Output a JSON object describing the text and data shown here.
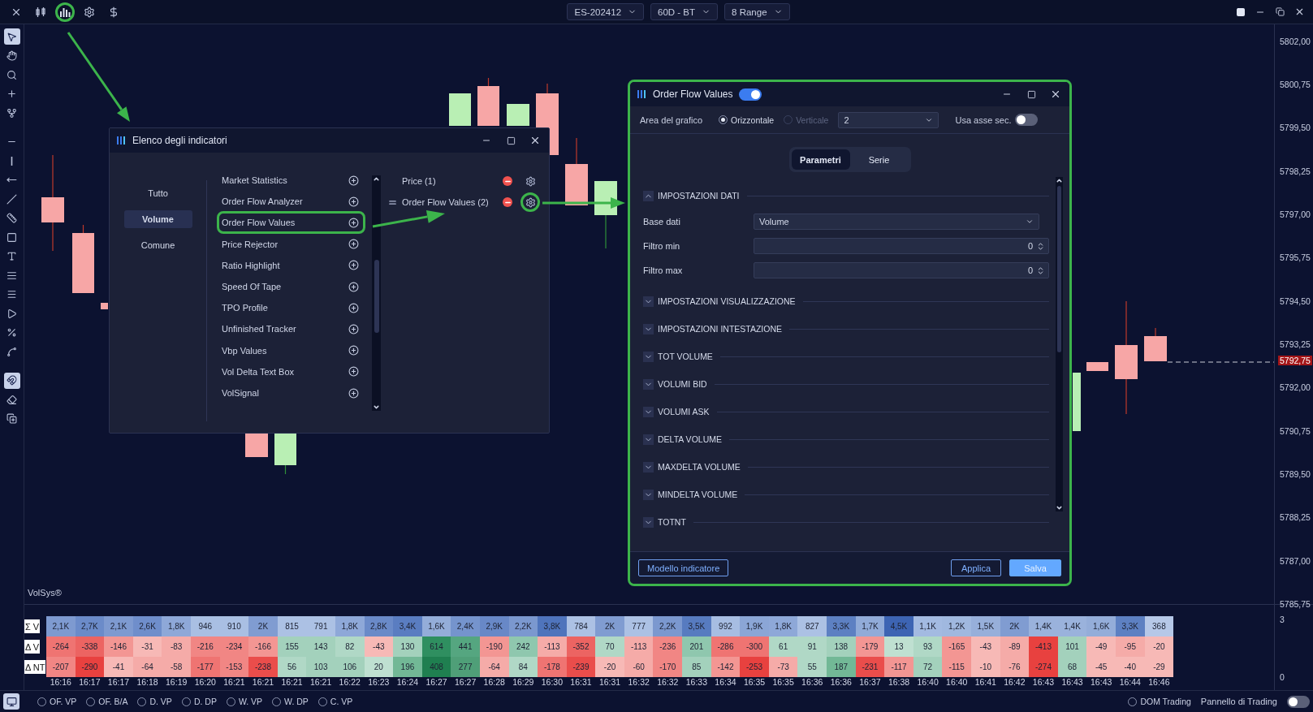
{
  "top_bar": {
    "tools": [
      {
        "highlighted": false
      },
      {
        "highlighted": false
      },
      {
        "highlighted": true
      },
      {
        "highlighted": false
      },
      {
        "highlighted": false
      }
    ],
    "selectors": [
      {
        "label": "ES-202412"
      },
      {
        "label": "60D - BT"
      },
      {
        "label": "8 Range"
      }
    ]
  },
  "left_toolbar": {
    "tools": [
      {
        "selected": true
      },
      {
        "selected": false
      },
      {
        "selected": false
      },
      {
        "selected": false
      },
      {
        "selected": false
      },
      {
        "selected": false
      },
      {
        "selected": false
      },
      {
        "selected": false
      },
      {
        "selected": false
      },
      {
        "selected": false
      },
      {
        "selected": false
      },
      {
        "selected": false
      },
      {
        "selected": false
      },
      {
        "selected": false
      },
      {
        "selected": false
      },
      {
        "selected": false
      },
      {
        "selected": false
      },
      {
        "selected": true
      },
      {
        "selected": false
      },
      {
        "selected": false
      }
    ]
  },
  "chart": {
    "study_label": "VolSys®"
  },
  "price_axis": {
    "labels": [
      "5802,00",
      "5800,75",
      "5799,50",
      "5798,25",
      "5797,00",
      "5795,75",
      "5794,50",
      "5793,25",
      "5792,00",
      "5790,75",
      "5789,50",
      "5788,25",
      "5787,00",
      "5785,75"
    ],
    "current_price": "5792,75",
    "sub_scale": [
      "3",
      "0"
    ]
  },
  "indicator_list_window": {
    "title": "Elenco degli indicatori",
    "categories": [
      {
        "label": "Tutto",
        "selected": false
      },
      {
        "label": "Volume",
        "selected": true
      },
      {
        "label": "Comune",
        "selected": false
      }
    ],
    "indicators": [
      {
        "label": "Market Statistics",
        "highlighted": false
      },
      {
        "label": "Order Flow Analyzer",
        "highlighted": false
      },
      {
        "label": "Order Flow Values",
        "highlighted": true
      },
      {
        "label": "Price Rejector",
        "highlighted": false
      },
      {
        "label": "Ratio Highlight",
        "highlighted": false
      },
      {
        "label": "Speed Of Tape",
        "highlighted": false
      },
      {
        "label": "TPO Profile",
        "highlighted": false
      },
      {
        "label": "Unfinished Tracker",
        "highlighted": false
      },
      {
        "label": "Vbp Values",
        "highlighted": false
      },
      {
        "label": "Vol Delta Text Box",
        "highlighted": false
      },
      {
        "label": "VolSignal",
        "highlighted": false
      }
    ],
    "added": [
      {
        "label": "Price (1)",
        "handle": false,
        "highlighted": false
      },
      {
        "label": "Order Flow Values (2)",
        "handle": true,
        "highlighted": true
      }
    ]
  },
  "settings_window": {
    "title": "Order Flow Values",
    "enabled": true,
    "highlighted": true,
    "chart_area_label": "Area del grafico",
    "orientation": [
      {
        "label": "Orizzontale",
        "selected": true,
        "disabled": false
      },
      {
        "label": "Verticale",
        "selected": false,
        "disabled": true
      }
    ],
    "pane": "2",
    "secondary_axis": {
      "label": "Usa asse sec.",
      "on": false
    },
    "tabs": [
      {
        "label": "Parametri",
        "selected": true
      },
      {
        "label": "Serie",
        "selected": false
      }
    ],
    "sections": [
      {
        "title": "IMPOSTAZIONI DATI",
        "expanded": true,
        "fields": [
          {
            "kind": "select",
            "label": "Base dati",
            "value": "Volume"
          },
          {
            "kind": "number",
            "label": "Filtro min",
            "value": "0"
          },
          {
            "kind": "number",
            "label": "Filtro max",
            "value": "0"
          }
        ]
      },
      {
        "title": "IMPOSTAZIONI VISUALIZZAZIONE",
        "expanded": false
      },
      {
        "title": "IMPOSTAZIONI INTESTAZIONE",
        "expanded": false
      },
      {
        "title": "TOT VOLUME",
        "expanded": false
      },
      {
        "title": "VOLUMI BID",
        "expanded": false
      },
      {
        "title": "VOLUMI ASK",
        "expanded": false
      },
      {
        "title": "DELTA VOLUME",
        "expanded": false
      },
      {
        "title": "MAXDELTA VOLUME",
        "expanded": false
      },
      {
        "title": "MINDELTA VOLUME",
        "expanded": false
      },
      {
        "title": "TOTNT",
        "expanded": false
      }
    ],
    "buttons": [
      {
        "label": "Modello indicatore",
        "kind": "outline"
      },
      {
        "label": "Applica",
        "kind": "outline"
      },
      {
        "label": "Salva",
        "kind": "primary"
      }
    ]
  },
  "volume_table": {
    "rows": [
      {
        "label": "Σ V",
        "cells": [
          {
            "text": "2,1K",
            "color": "#7e9ad0"
          },
          {
            "text": "2,7K",
            "color": "#6b8bc9"
          },
          {
            "text": "2,1K",
            "color": "#7e9ad0"
          },
          {
            "text": "2,6K",
            "color": "#6f8ecb"
          },
          {
            "text": "1,8K",
            "color": "#8ea8d8"
          },
          {
            "text": "946",
            "color": "#a9bfe3"
          },
          {
            "text": "910",
            "color": "#a9bfe3"
          },
          {
            "text": "2K",
            "color": "#809cd1"
          },
          {
            "text": "815",
            "color": "#acc1e4"
          },
          {
            "text": "791",
            "color": "#acc1e4"
          },
          {
            "text": "1,8K",
            "color": "#8ea8d8"
          },
          {
            "text": "2,8K",
            "color": "#6a8ac8"
          },
          {
            "text": "3,4K",
            "color": "#5a7dc1"
          },
          {
            "text": "1,6K",
            "color": "#94add9"
          },
          {
            "text": "2,4K",
            "color": "#7594cd"
          },
          {
            "text": "2,9K",
            "color": "#6888c7"
          },
          {
            "text": "2,2K",
            "color": "#7b98cf"
          },
          {
            "text": "3,8K",
            "color": "#4f74bc"
          },
          {
            "text": "784",
            "color": "#acc1e4"
          },
          {
            "text": "2K",
            "color": "#809cd1"
          },
          {
            "text": "777",
            "color": "#acc1e4"
          },
          {
            "text": "2,2K",
            "color": "#7b98cf"
          },
          {
            "text": "3,5K",
            "color": "#577bc0"
          },
          {
            "text": "992",
            "color": "#a7bde2"
          },
          {
            "text": "1,9K",
            "color": "#8ba6d6"
          },
          {
            "text": "1,8K",
            "color": "#8ea8d8"
          },
          {
            "text": "827",
            "color": "#acc1e4"
          },
          {
            "text": "3,3K",
            "color": "#5d80c2"
          },
          {
            "text": "1,7K",
            "color": "#91abd8"
          },
          {
            "text": "4,5K",
            "color": "#3d64b3"
          },
          {
            "text": "1,1K",
            "color": "#a3bae1"
          },
          {
            "text": "1,2K",
            "color": "#a0b8df"
          },
          {
            "text": "1,5K",
            "color": "#97afda"
          },
          {
            "text": "2K",
            "color": "#809cd1"
          },
          {
            "text": "1,4K",
            "color": "#9ab2dc"
          },
          {
            "text": "1,4K",
            "color": "#9ab2dc"
          },
          {
            "text": "1,6K",
            "color": "#94add9"
          },
          {
            "text": "3,3K",
            "color": "#5d80c2"
          },
          {
            "text": "368",
            "color": "#b6c8e8"
          }
        ]
      },
      {
        "label": "Δ V",
        "cells": [
          {
            "text": "-264",
            "color": "#ef7472"
          },
          {
            "text": "-338",
            "color": "#ec6462"
          },
          {
            "text": "-146",
            "color": "#f39693"
          },
          {
            "text": "-31",
            "color": "#f7b9b6"
          },
          {
            "text": "-83",
            "color": "#f5aba8"
          },
          {
            "text": "-216",
            "color": "#f18684"
          },
          {
            "text": "-234",
            "color": "#f18684"
          },
          {
            "text": "-166",
            "color": "#f39693"
          },
          {
            "text": "155",
            "color": "#a3d1bc"
          },
          {
            "text": "143",
            "color": "#a3d1bc"
          },
          {
            "text": "82",
            "color": "#b0d8c6"
          },
          {
            "text": "-43",
            "color": "#f7b9b6"
          },
          {
            "text": "130",
            "color": "#a3d1bc"
          },
          {
            "text": "614",
            "color": "#2f8f60"
          },
          {
            "text": "441",
            "color": "#55a680"
          },
          {
            "text": "-190",
            "color": "#f39693"
          },
          {
            "text": "242",
            "color": "#8fc7ae"
          },
          {
            "text": "-113",
            "color": "#f5aba8"
          },
          {
            "text": "-352",
            "color": "#ec6462"
          },
          {
            "text": "70",
            "color": "#b0d8c6"
          },
          {
            "text": "-113",
            "color": "#f5aba8"
          },
          {
            "text": "-236",
            "color": "#f18684"
          },
          {
            "text": "201",
            "color": "#8fc7ae"
          },
          {
            "text": "-286",
            "color": "#ef7472"
          },
          {
            "text": "-300",
            "color": "#ef7472"
          },
          {
            "text": "61",
            "color": "#b0d8c6"
          },
          {
            "text": "91",
            "color": "#b0d8c6"
          },
          {
            "text": "138",
            "color": "#a3d1bc"
          },
          {
            "text": "-179",
            "color": "#f39693"
          },
          {
            "text": "13",
            "color": "#bfe0d1"
          },
          {
            "text": "93",
            "color": "#b0d8c6"
          },
          {
            "text": "-165",
            "color": "#f39693"
          },
          {
            "text": "-43",
            "color": "#f7b9b6"
          },
          {
            "text": "-89",
            "color": "#f5aba8"
          },
          {
            "text": "-413",
            "color": "#e8413f"
          },
          {
            "text": "101",
            "color": "#a3d1bc"
          },
          {
            "text": "-49",
            "color": "#f7b9b6"
          },
          {
            "text": "-95",
            "color": "#f5aba8"
          },
          {
            "text": "-20",
            "color": "#f7b9b6"
          }
        ]
      },
      {
        "label": "Δ NT",
        "cells": [
          {
            "text": "-207",
            "color": "#f18684"
          },
          {
            "text": "-290",
            "color": "#e8413f"
          },
          {
            "text": "-41",
            "color": "#f7b9b6"
          },
          {
            "text": "-64",
            "color": "#f5aba8"
          },
          {
            "text": "-58",
            "color": "#f5aba8"
          },
          {
            "text": "-177",
            "color": "#ef7472"
          },
          {
            "text": "-153",
            "color": "#f18684"
          },
          {
            "text": "-238",
            "color": "#ea4d4b"
          },
          {
            "text": "56",
            "color": "#b0d8c6"
          },
          {
            "text": "103",
            "color": "#a3d1bc"
          },
          {
            "text": "106",
            "color": "#a3d1bc"
          },
          {
            "text": "20",
            "color": "#bfe0d1"
          },
          {
            "text": "196",
            "color": "#72b896"
          },
          {
            "text": "408",
            "color": "#1f7f50"
          },
          {
            "text": "277",
            "color": "#4f9f78"
          },
          {
            "text": "-64",
            "color": "#f5aba8"
          },
          {
            "text": "84",
            "color": "#b0d8c6"
          },
          {
            "text": "-178",
            "color": "#ef7472"
          },
          {
            "text": "-239",
            "color": "#ea4d4b"
          },
          {
            "text": "-20",
            "color": "#f7b9b6"
          },
          {
            "text": "-60",
            "color": "#f5aba8"
          },
          {
            "text": "-170",
            "color": "#f18684"
          },
          {
            "text": "85",
            "color": "#a3d1bc"
          },
          {
            "text": "-142",
            "color": "#f39693"
          },
          {
            "text": "-253",
            "color": "#e8413f"
          },
          {
            "text": "-73",
            "color": "#f5aba8"
          },
          {
            "text": "55",
            "color": "#b0d8c6"
          },
          {
            "text": "187",
            "color": "#72b896"
          },
          {
            "text": "-231",
            "color": "#ea4d4b"
          },
          {
            "text": "-117",
            "color": "#f39693"
          },
          {
            "text": "72",
            "color": "#a3d1bc"
          },
          {
            "text": "-115",
            "color": "#f39693"
          },
          {
            "text": "-10",
            "color": "#f7b9b6"
          },
          {
            "text": "-76",
            "color": "#f5aba8"
          },
          {
            "text": "-274",
            "color": "#e8413f"
          },
          {
            "text": "68",
            "color": "#a3d1bc"
          },
          {
            "text": "-45",
            "color": "#f7b9b6"
          },
          {
            "text": "-40",
            "color": "#f7b9b6"
          },
          {
            "text": "-29",
            "color": "#f7b9b6"
          }
        ]
      }
    ],
    "times": [
      "16:16",
      "16:17",
      "16:17",
      "16:18",
      "16:19",
      "16:20",
      "16:21",
      "16:21",
      "16:21",
      "16:21",
      "16:22",
      "16:23",
      "16:24",
      "16:27",
      "16:27",
      "16:28",
      "16:29",
      "16:30",
      "16:31",
      "16:31",
      "16:32",
      "16:32",
      "16:33",
      "16:34",
      "16:35",
      "16:35",
      "16:36",
      "16:36",
      "16:37",
      "16:38",
      "16:40",
      "16:40",
      "16:41",
      "16:42",
      "16:43",
      "16:43",
      "16:43",
      "16:44",
      "16:46"
    ]
  },
  "bottom_bar": {
    "options": [
      {
        "label": "OF. VP",
        "selected": false
      },
      {
        "label": "OF. B/A",
        "selected": false
      },
      {
        "label": "D. VP",
        "selected": false
      },
      {
        "label": "D. DP",
        "selected": false
      },
      {
        "label": "W. VP",
        "selected": false
      },
      {
        "label": "W. DP",
        "selected": false
      },
      {
        "label": "C. VP",
        "selected": false
      }
    ],
    "dom_trading": {
      "label": "DOM Trading",
      "selected": false
    },
    "trading_panel": {
      "label": "Pannello di Trading",
      "on": false
    }
  }
}
